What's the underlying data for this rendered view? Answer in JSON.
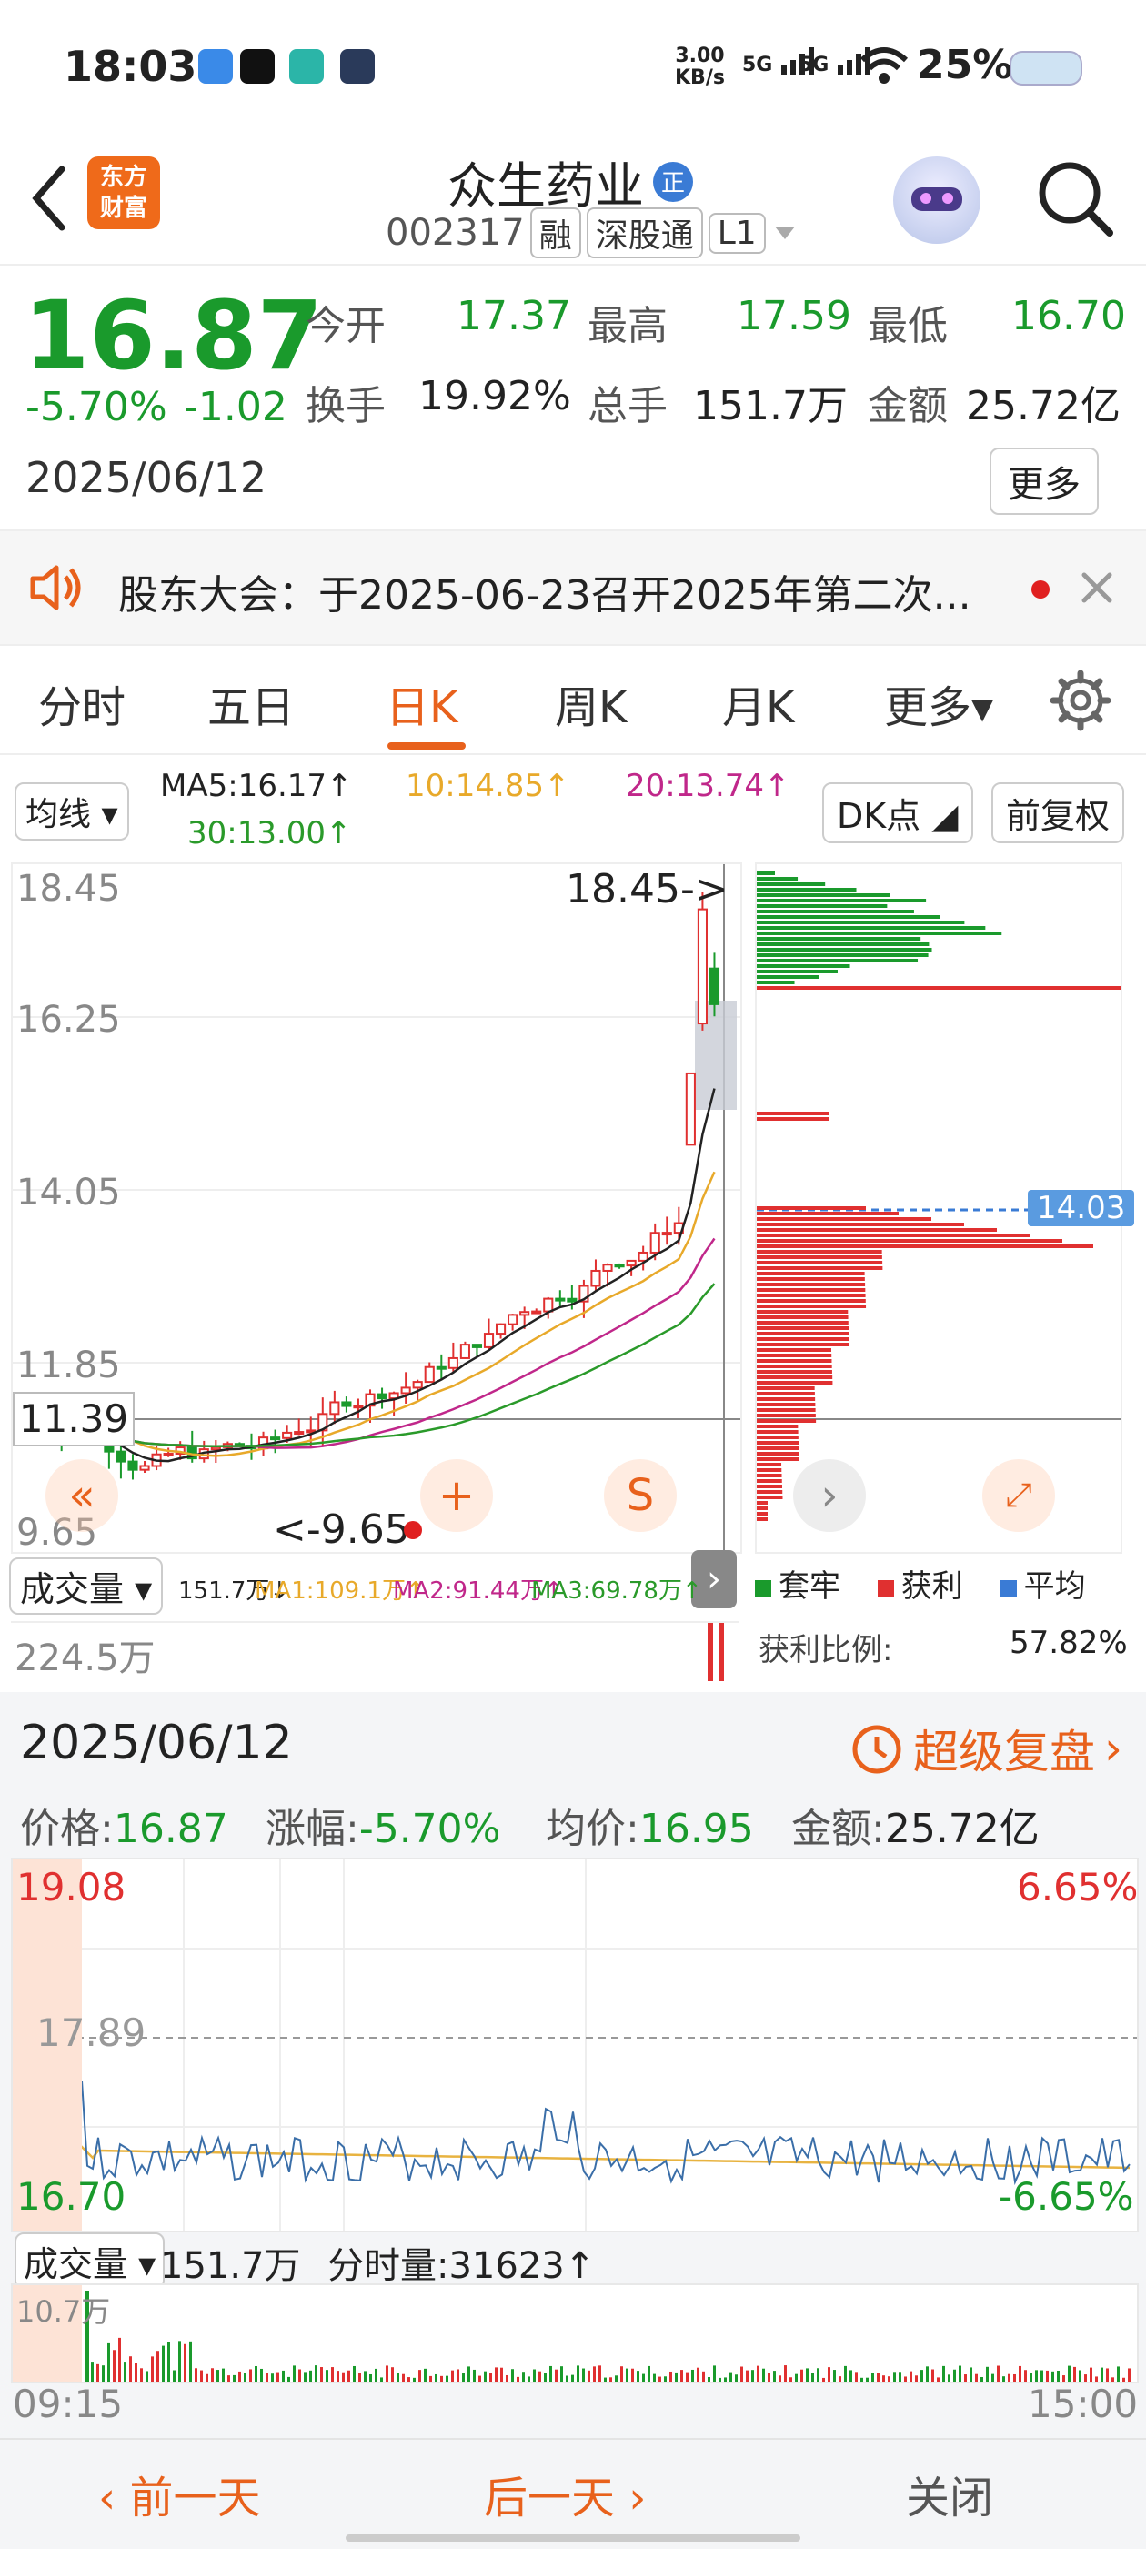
{
  "status_bar": {
    "time": "18:03",
    "net_speed_top": "3.00",
    "net_speed_bottom": "KB/s",
    "signal1": "5G",
    "signal2": "5G",
    "battery": "25%"
  },
  "header": {
    "logo_text_1": "东方",
    "logo_text_2": "财富",
    "stock_name": "众生药业",
    "badge": "正",
    "code": "002317",
    "tags": [
      "融",
      "深股通",
      "L1"
    ]
  },
  "quote": {
    "price": "16.87",
    "change_pct": "-5.70%",
    "change_amt": "-1.02",
    "date": "2025/06/12",
    "open_label": "今开",
    "open_value": "17.37",
    "high_label": "最高",
    "high_value": "17.59",
    "low_label": "最低",
    "low_value": "16.70",
    "turnover_label": "换手",
    "turnover_value": "19.92%",
    "volume_label": "总手",
    "volume_value": "151.7万",
    "amount_label": "金额",
    "amount_value": "25.72亿",
    "more_label": "更多"
  },
  "notice": {
    "text": "股东大会：于2025-06-23召开2025年第二次..."
  },
  "tabs": [
    {
      "label": "分时"
    },
    {
      "label": "五日"
    },
    {
      "label": "日K"
    },
    {
      "label": "周K"
    },
    {
      "label": "月K"
    },
    {
      "label": "更多▾"
    }
  ],
  "kline": {
    "indicator_select": "均线",
    "ma5": "MA5:16.17↑",
    "ma10": "10:14.85↑",
    "ma20": "20:13.74↑",
    "ma30": "30:13.00↑",
    "dk_button": "DK点",
    "adjust_button": "前复权",
    "axis_labels": [
      "18.45",
      "16.25",
      "14.05",
      "11.85",
      "9.65"
    ],
    "crosshair_value": "11.39",
    "high_mark": "18.45->",
    "low_mark": "<-9.65",
    "chip_price": "14.03",
    "volume_select": "成交量",
    "vol_value": "151.7万↓",
    "vol_ma1": "MA1:109.1万↑",
    "vol_ma2": "MA2:91.44万↑",
    "vol_ma3": "MA3:69.78万↑",
    "vol_axis": "224.5万",
    "legend_trapped": "套牢",
    "legend_profit": "获利",
    "legend_avg": "平均",
    "profit_ratio_label": "获利比例:",
    "profit_ratio_value": "57.82%",
    "colors": {
      "up": "#e03030",
      "down": "#1a9a2c",
      "ma5": "#222222",
      "ma10": "#e8a92a",
      "ma20": "#c0278a",
      "ma30": "#2a9a2a"
    }
  },
  "review": {
    "date": "2025/06/12",
    "super_review": "超级复盘",
    "price_label": "价格:",
    "price_value": "16.87",
    "change_label": "涨幅:",
    "change_value": "-5.70%",
    "avg_label": "均价:",
    "avg_value": "16.95",
    "amount_label": "金额:",
    "amount_value": "25.72亿",
    "top_price": "19.08",
    "mid_price": "17.89",
    "bottom_price": "16.70",
    "top_pct": "6.65%",
    "bottom_pct": "-6.65%",
    "volume_select": "成交量",
    "volume_total": "151.7万",
    "tick_volume": "分时量:31623↑",
    "vol_axis": "10.7万",
    "time_start": "09:15",
    "time_end": "15:00"
  },
  "bottom_nav": {
    "prev": "前一天",
    "next": "后一天",
    "close": "关闭"
  }
}
